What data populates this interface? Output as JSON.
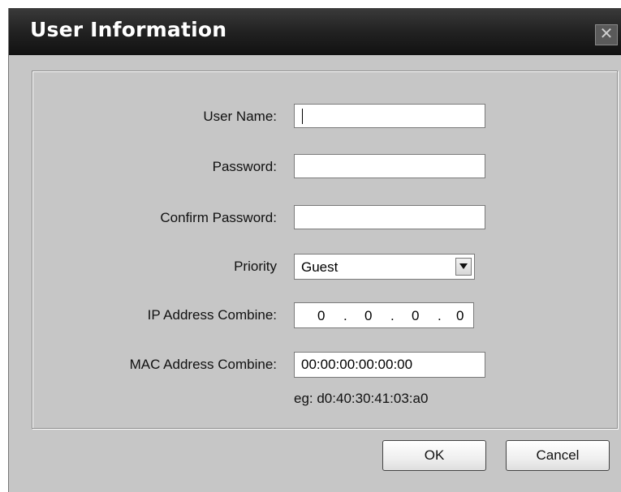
{
  "dialog": {
    "title": "User Information",
    "close_glyph": "✕"
  },
  "form": {
    "user_name_label": "User Name:",
    "user_name_value": "",
    "password_label": "Password:",
    "password_value": "",
    "confirm_password_label": "Confirm Password:",
    "confirm_password_value": "",
    "priority_label": "Priority",
    "priority_value": "Guest",
    "ip_label": "IP Address Combine:",
    "ip_octets": [
      "0",
      "0",
      "0",
      "0"
    ],
    "ip_separator": ".",
    "mac_label": "MAC Address Combine:",
    "mac_value": "00:00:00:00:00:00",
    "mac_hint": "eg: d0:40:30:41:03:a0"
  },
  "buttons": {
    "ok": "OK",
    "cancel": "Cancel"
  },
  "icons": {
    "close": "close-icon",
    "dropdown": "chevron-down-icon"
  }
}
